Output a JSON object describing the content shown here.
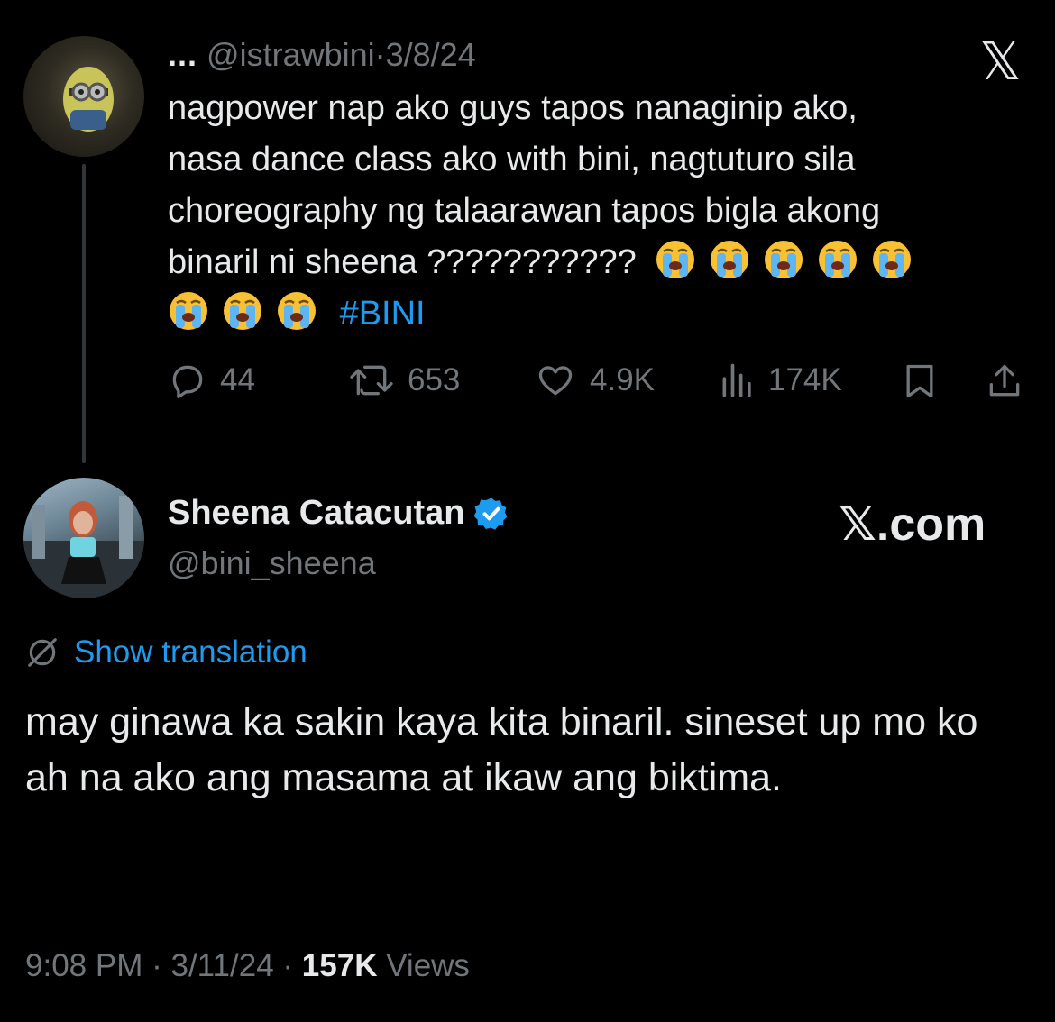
{
  "parent": {
    "display_name": "...",
    "handle": "@istrawbini",
    "separator": "·",
    "date": "3/8/24",
    "text_lines": [
      "nagpower nap ako guys tapos nanaginip ako,",
      "nasa dance class ako with bini, nagtuturo sila",
      "choreography ng talaarawan tapos bigla akong",
      "binaril ni sheena ???????????"
    ],
    "hashtag": "#BINI",
    "emoji": "loudly-crying-face",
    "replies": "44",
    "reposts": "653",
    "likes": "4.9K",
    "views": "174K",
    "icons": [
      "reply-icon",
      "repost-icon",
      "like-icon",
      "views-icon",
      "bookmark-icon",
      "share-icon"
    ]
  },
  "reply": {
    "display_name": "Sheena Catacutan",
    "handle": "@bini_sheena",
    "verified": true,
    "translate_label": "Show translation",
    "text": "may ginawa ka sakin kaya kita binaril. sineset up mo ko ah na ako ang masama at ikaw ang biktima.",
    "time": "9:08 PM",
    "separator": "·",
    "date": "3/11/24",
    "views_count": "157K",
    "views_label": "Views"
  },
  "branding": {
    "x_logo": "𝕏",
    "xcom_label": "𝕏.com"
  },
  "colors": {
    "background": "#000000",
    "text": "#e7e9ea",
    "muted": "#71767b",
    "accent": "#1d9bf0"
  }
}
